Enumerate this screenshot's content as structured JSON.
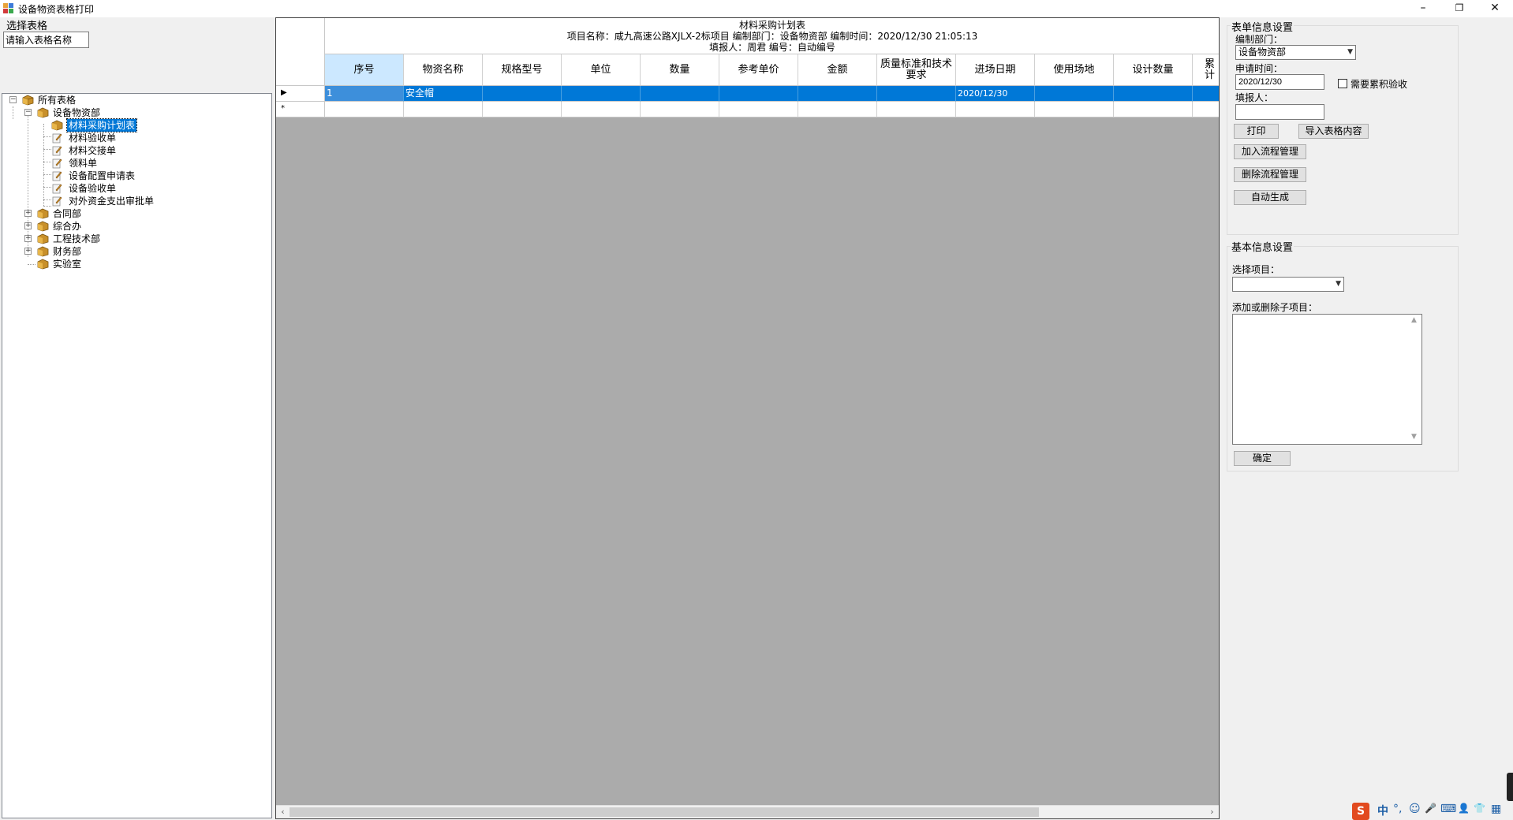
{
  "window": {
    "title": "设备物资表格打印",
    "minimize": "–",
    "restore": "❐",
    "close": "✕"
  },
  "left": {
    "select_label": "选择表格",
    "search_value": "请输入表格名称",
    "tree": {
      "root": "所有表格",
      "dept1": "设备物资部",
      "dept1_items": [
        "材料采购计划表",
        "材料验收单",
        "材料交接单",
        "领料单",
        "设备配置申请表",
        "设备验收单",
        "对外资金支出审批单"
      ],
      "selected_item": "材料采购计划表",
      "other_depts": [
        "合同部",
        "综合办",
        "工程技术部",
        "财务部",
        "实验室"
      ]
    }
  },
  "grid": {
    "title_line1": "材料采购计划表",
    "title_line2": "项目名称：咸九高速公路XJLX-2标项目   编制部门：设备物资部   编制时间：2020/12/30  21:05:13",
    "title_line3": "填报人：周君     编号：自动编号",
    "columns": [
      "序号",
      "物资名称",
      "规格型号",
      "单位",
      "数量",
      "参考单价",
      "金额",
      "质量标准和技术要求",
      "进场日期",
      "使用场地",
      "设计数量",
      "累计"
    ],
    "rows": [
      {
        "marker": "▶",
        "cells": [
          "1",
          "安全帽",
          "",
          "",
          "",
          "",
          "",
          "",
          "2020/12/30",
          "",
          "",
          ""
        ]
      },
      {
        "marker": "*",
        "cells": [
          "",
          "",
          "",
          "",
          "",
          "",
          "",
          "",
          "",
          "",
          "",
          ""
        ]
      }
    ],
    "scroll_left": "‹",
    "scroll_right": "›"
  },
  "form_settings": {
    "group_title": "表单信息设置",
    "dept_label": "编制部门：",
    "dept_value": "设备物资部",
    "date_label": "申请时间：",
    "date_value": "2020/12/30",
    "accum_check_label": "需要累积验收",
    "filler_label": "填报人：",
    "filler_value": "",
    "print_button": "打印",
    "import_button": "导入表格内容",
    "add_flow_button": "加入流程管理",
    "delete_flow_button": "删除流程管理",
    "auto_generate_button": "自动生成"
  },
  "basic_settings": {
    "group_title": "基本信息设置",
    "project_label": "选择项目：",
    "project_value": "",
    "subitem_label": "添加或删除子项目：",
    "confirm_button": "确定"
  },
  "tray": {
    "ime": "S",
    "lang": "中",
    "punct": "°,",
    "emoji": "☺",
    "mic": "🎤",
    "keyboard": "⌨",
    "user": "👤",
    "shirt": "👕",
    "grid": "▦"
  }
}
